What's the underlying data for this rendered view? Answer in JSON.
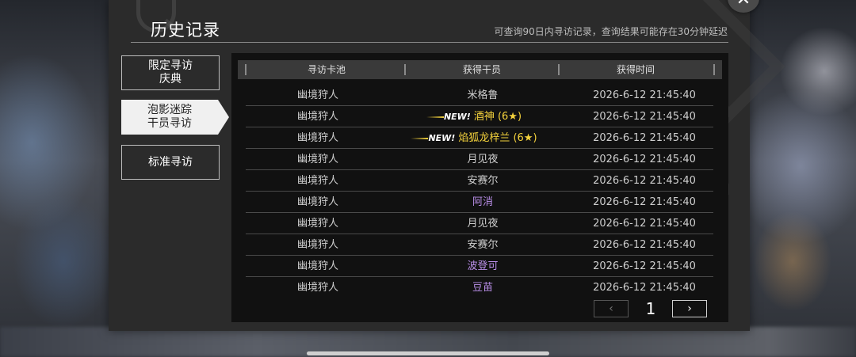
{
  "dialog": {
    "title": "历史记录",
    "subtitle": "可查询90日内寻访记录，查询结果可能存在30分钟延迟",
    "close_icon": "✕"
  },
  "nav": [
    {
      "label_line1": "限定寻访",
      "label_line2": "庆典",
      "selected": false
    },
    {
      "label_line1": "泡影迷踪",
      "label_line2": "干员寻访",
      "selected": true
    },
    {
      "label_line1": "标准寻访",
      "label_line2": "",
      "selected": false
    }
  ],
  "table": {
    "headers": [
      "寻访卡池",
      "获得干员",
      "获得时间"
    ],
    "rows": [
      {
        "pool": "幽境狩人",
        "new_tag": "",
        "operator": "米格鲁",
        "time": "2026-6-12 21:45:40",
        "rarity": "normal"
      },
      {
        "pool": "幽境狩人",
        "new_tag": "NEW!",
        "operator": "酒神 (6★)",
        "time": "2026-6-12 21:45:40",
        "rarity": "gold"
      },
      {
        "pool": "幽境狩人",
        "new_tag": "NEW!",
        "operator": "焰狐龙梓兰 (6★)",
        "time": "2026-6-12 21:45:40",
        "rarity": "gold"
      },
      {
        "pool": "幽境狩人",
        "new_tag": "",
        "operator": "月见夜",
        "time": "2026-6-12 21:45:40",
        "rarity": "normal"
      },
      {
        "pool": "幽境狩人",
        "new_tag": "",
        "operator": "安赛尔",
        "time": "2026-6-12 21:45:40",
        "rarity": "normal"
      },
      {
        "pool": "幽境狩人",
        "new_tag": "",
        "operator": "阿消",
        "time": "2026-6-12 21:45:40",
        "rarity": "purple"
      },
      {
        "pool": "幽境狩人",
        "new_tag": "",
        "operator": "月见夜",
        "time": "2026-6-12 21:45:40",
        "rarity": "normal"
      },
      {
        "pool": "幽境狩人",
        "new_tag": "",
        "operator": "安赛尔",
        "time": "2026-6-12 21:45:40",
        "rarity": "normal"
      },
      {
        "pool": "幽境狩人",
        "new_tag": "",
        "operator": "波登可",
        "time": "2026-6-12 21:45:40",
        "rarity": "purple"
      },
      {
        "pool": "幽境狩人",
        "new_tag": "",
        "operator": "豆苗",
        "time": "2026-6-12 21:45:40",
        "rarity": "purple"
      }
    ]
  },
  "pagination": {
    "current_page": "1",
    "prev_icon": "‹",
    "next_icon": "›"
  },
  "colors": {
    "rarity_gold": "#f4d23c",
    "rarity_purple": "#b98ee8",
    "panel_bg": "#111111"
  }
}
